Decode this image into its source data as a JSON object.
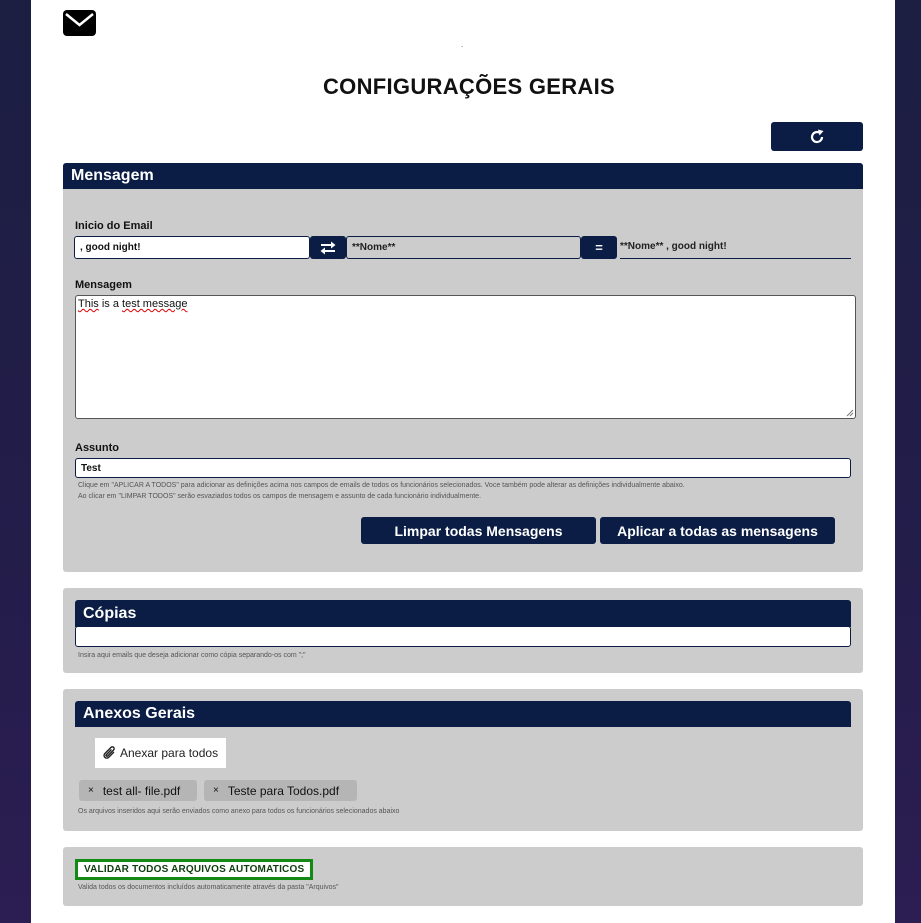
{
  "icons": {
    "mail": "envelope-icon",
    "refresh": "refresh-icon",
    "swap": "swap-arrows-icon",
    "attach": "paperclip-icon"
  },
  "colors": {
    "navy": "#0b1d45",
    "panel": "#cccccc",
    "validate_border": "#138a13"
  },
  "page": {
    "title": "CONFIGURAÇÕES GERAIS",
    "dot": "."
  },
  "mensagem": {
    "header": "Mensagem",
    "inicio_label": "Inicio do Email",
    "inicio_value": ", good night!",
    "nome_field": "**Nome**",
    "equals_label": "=",
    "preview": "**Nome** , good night!",
    "mensagem_label": "Mensagem",
    "mensagem_value_part1": "This",
    "mensagem_value_part2": " is a ",
    "mensagem_value_part3": "test message",
    "assunto_label": "Assunto",
    "assunto_value": "Test",
    "help_line1": "Clique em \"APLICAR A TODOS\" para adicionar as definições acima nos campos de emails de todos os funcionários selecionados. Voce também pode alterar as definições individualmente abaixo.",
    "help_line2": "Ao clicar em \"LIMPAR TODOS\" serão esvaziados todos os campos de mensagem e assunto de cada funcionário individualmente.",
    "clear_button": "Limpar todas Mensagens",
    "apply_button": "Aplicar a todas as mensagens"
  },
  "copias": {
    "header": "Cópias",
    "value": "",
    "help": "Insira aqui emails que deseja adicionar como cópia separando-os com \";\""
  },
  "anexos": {
    "header": "Anexos Gerais",
    "attach_button": "Anexar para todos",
    "files": [
      {
        "remove": "×",
        "name": "test all- file.pdf"
      },
      {
        "remove": "×",
        "name": "Teste para Todos.pdf"
      }
    ],
    "help": "Os arquivos inseridos aqui serão enviados como anexo para todos os funcionários selecionados abaixo"
  },
  "validar": {
    "button": "VALIDAR TODOS ARQUIVOS AUTOMATICOS",
    "help": "Valida todos os documentos incluídos automaticamente através da pasta \"Arquivos\""
  }
}
